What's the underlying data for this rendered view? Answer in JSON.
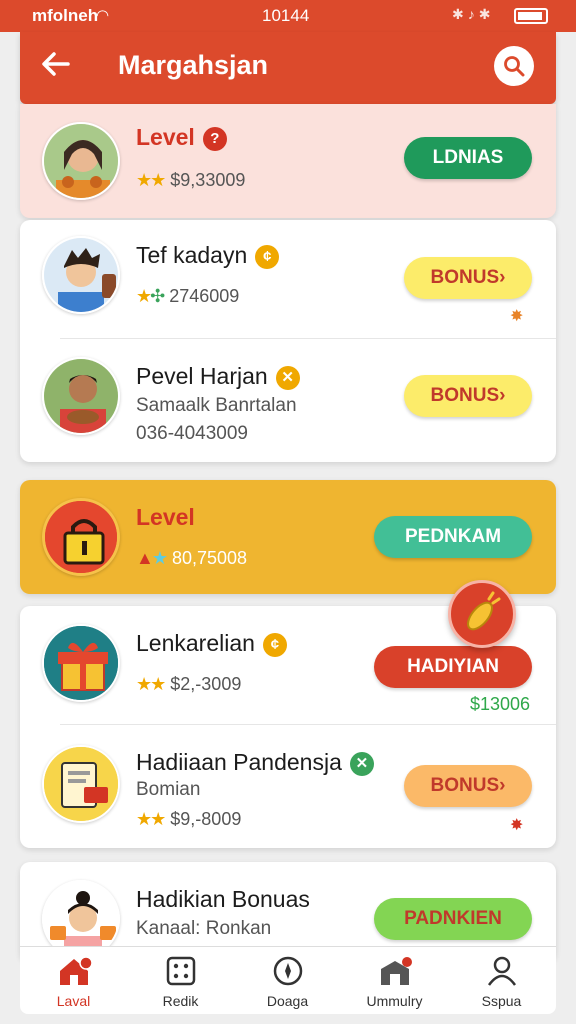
{
  "status_bar": {
    "carrier": "mfolneh",
    "time": "10144"
  },
  "app_bar": {
    "title": "Margahsjan"
  },
  "cards": [
    {
      "name": "Level",
      "stars_text": "$9,33009",
      "button": "LDNIAS"
    },
    {
      "name": "Tef kadayn",
      "stars_text": "2746009",
      "button": "BONUS›"
    },
    {
      "name": "Pevel Harjan",
      "sub1": "Samaalk Banrtalan",
      "sub2": "036-4043009",
      "button": "BONUS›"
    },
    {
      "name": "Level",
      "stars_text": "80,75008",
      "button": "PEDNKAM"
    },
    {
      "name": "Lenkarelian",
      "stars_text": "$2,-3009",
      "button": "HADIYIAN",
      "price": "$13006"
    },
    {
      "name": "Hadiiaan Pandensja",
      "sub1": "Bomian",
      "stars_text": "$9,-8009",
      "button": "BONUS›"
    },
    {
      "name": "Hadikian Bonuas",
      "sub1": "Kanaal: Ronkan",
      "button": "PADNKIEN"
    }
  ],
  "bottom_nav": [
    {
      "label": "Laval",
      "icon": "home-icon",
      "active": true
    },
    {
      "label": "Redik",
      "icon": "grid-icon",
      "active": false
    },
    {
      "label": "Doaga",
      "icon": "compass-icon",
      "active": false
    },
    {
      "label": "Ummulry",
      "icon": "store-icon",
      "active": false
    },
    {
      "label": "Sspua",
      "icon": "profile-icon",
      "active": false
    }
  ],
  "colors": {
    "primary": "#dc4a2c",
    "highlight_pink": "#fbe1dc",
    "highlight_gold": "#efb530",
    "price_green": "#2fa84a"
  }
}
